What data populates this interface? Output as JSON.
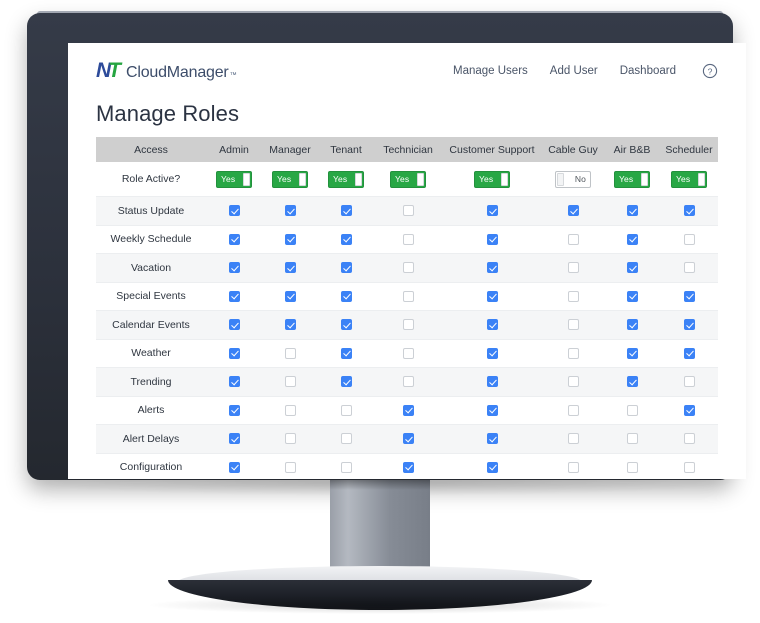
{
  "brand": {
    "mark_n": "N",
    "mark_t": "T",
    "word": "CloudManager",
    "tm": "™"
  },
  "nav": {
    "links": [
      {
        "label": "Manage Users"
      },
      {
        "label": "Add User"
      },
      {
        "label": "Dashboard"
      }
    ],
    "help_icon": "help-circle-icon"
  },
  "page": {
    "title": "Manage Roles"
  },
  "table": {
    "columns": [
      "Access",
      "Admin",
      "Manager",
      "Tenant",
      "Technician",
      "Customer Support",
      "Cable Guy",
      "Air B&B",
      "Scheduler"
    ],
    "toggle_row": {
      "label": "Role Active?",
      "on_label": "Yes",
      "off_label": "No",
      "values": [
        true,
        true,
        true,
        true,
        true,
        false,
        true,
        true
      ]
    },
    "rows": [
      {
        "label": "Status Update",
        "values": [
          true,
          true,
          true,
          false,
          true,
          true,
          true,
          true
        ]
      },
      {
        "label": "Weekly Schedule",
        "values": [
          true,
          true,
          true,
          false,
          true,
          false,
          true,
          false
        ]
      },
      {
        "label": "Vacation",
        "values": [
          true,
          true,
          true,
          false,
          true,
          false,
          true,
          false
        ]
      },
      {
        "label": "Special Events",
        "values": [
          true,
          true,
          true,
          false,
          true,
          false,
          true,
          true
        ]
      },
      {
        "label": "Calendar Events",
        "values": [
          true,
          true,
          true,
          false,
          true,
          false,
          true,
          true
        ]
      },
      {
        "label": "Weather",
        "values": [
          true,
          false,
          true,
          false,
          true,
          false,
          true,
          true
        ]
      },
      {
        "label": "Trending",
        "values": [
          true,
          false,
          true,
          false,
          true,
          false,
          true,
          false
        ]
      },
      {
        "label": "Alerts",
        "values": [
          true,
          false,
          false,
          true,
          true,
          false,
          false,
          true
        ]
      },
      {
        "label": "Alert Delays",
        "values": [
          true,
          false,
          false,
          true,
          true,
          false,
          false,
          false
        ]
      },
      {
        "label": "Configuration",
        "values": [
          true,
          false,
          false,
          true,
          true,
          false,
          false,
          false
        ]
      }
    ]
  },
  "colors": {
    "header_bg": "#cfcfcf",
    "toggle_on": "#28a745",
    "checkbox_checked": "#3b82f6",
    "bezel": "#2e3440",
    "logo_blue": "#2d4b9a",
    "logo_green": "#26a541"
  }
}
